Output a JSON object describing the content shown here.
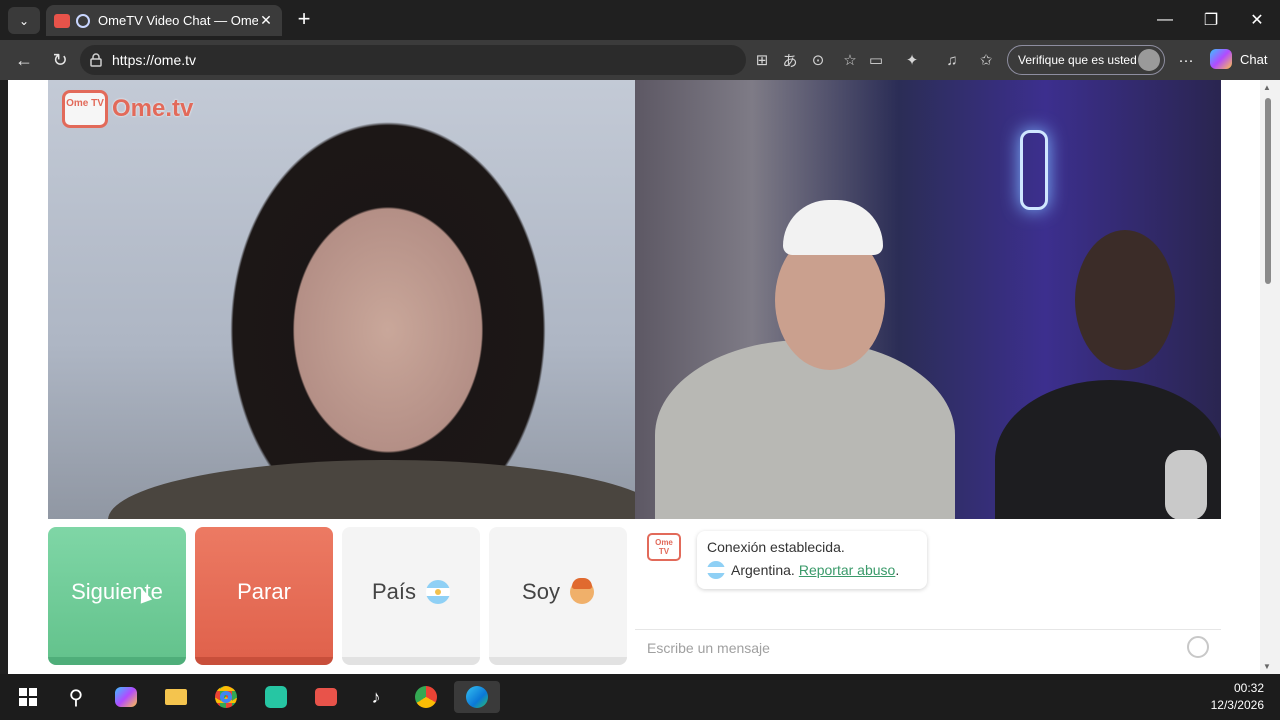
{
  "browser": {
    "tab_title": "OmeTV Video Chat — Omegle",
    "tab_close": "✕",
    "new_tab": "+",
    "url_host": "https://ome.tv",
    "verify_label": "Verifique que es usted",
    "more_label": "···",
    "copilot_label": "Chat",
    "window_controls": [
      "—",
      "❐",
      "✕"
    ]
  },
  "site": {
    "logo_badge": "Ome TV",
    "logo_text": "Ome.tv"
  },
  "controls": {
    "next_label": "Siguiente",
    "stop_label": "Parar",
    "country_label": "País",
    "gender_label": "Soy"
  },
  "chat": {
    "system_badge": "Ome TV",
    "message_line1": "Conexión establecida.",
    "country": "Argentina.",
    "report_link": "Reportar abuso",
    "period": ".",
    "input_placeholder": "Escribe un mensaje"
  },
  "taskbar": {
    "time": "00:32",
    "date": "12/3/2026",
    "apps": [
      "windows-start",
      "search",
      "copilot",
      "file-explorer",
      "chrome",
      "app-green",
      "app-tv",
      "tiktok",
      "chrome-profile",
      "edge"
    ]
  },
  "colors": {
    "next_green": "#6fcb97",
    "stop_red": "#e66b55",
    "brand_orange": "#e26a5a",
    "link_green": "#3a9a6a"
  }
}
